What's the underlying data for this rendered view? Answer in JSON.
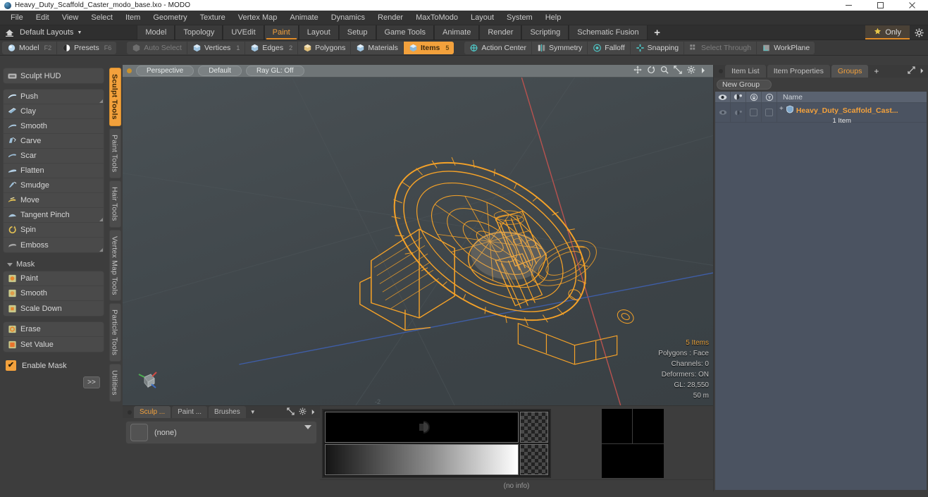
{
  "window": {
    "title": "Heavy_Duty_Scaffold_Caster_modo_base.lxo - MODO",
    "logo_icon": "modo-sphere-icon",
    "controls": [
      {
        "name": "minimize",
        "icon": "minimize-icon"
      },
      {
        "name": "maximize",
        "icon": "maximize-icon"
      },
      {
        "name": "close",
        "icon": "close-icon"
      }
    ]
  },
  "menubar": {
    "items": [
      "File",
      "Edit",
      "View",
      "Select",
      "Item",
      "Geometry",
      "Texture",
      "Vertex Map",
      "Animate",
      "Dynamics",
      "Render",
      "MaxToModo",
      "Layout",
      "System",
      "Help"
    ]
  },
  "layoutbar": {
    "home_icon": "home-icon",
    "layout_label": "Default Layouts",
    "caret_icon": "chevron-down-icon",
    "tabs": [
      {
        "label": "Model",
        "active": false
      },
      {
        "label": "Topology",
        "active": false
      },
      {
        "label": "UVEdit",
        "active": false
      },
      {
        "label": "Paint",
        "active": true
      },
      {
        "label": "Layout",
        "active": false
      },
      {
        "label": "Setup",
        "active": false
      },
      {
        "label": "Game Tools",
        "active": false
      },
      {
        "label": "Animate",
        "active": false
      },
      {
        "label": "Render",
        "active": false
      },
      {
        "label": "Scripting",
        "active": false
      },
      {
        "label": "Schematic Fusion",
        "active": false
      }
    ],
    "add_label": "+",
    "only_label": "Only",
    "only_icon": "star-icon",
    "gear_icon": "gear-icon",
    "accent": "#e08b27"
  },
  "modebar": {
    "left_group": [
      {
        "label": "Model",
        "key": "F2",
        "icon": "sphere-icon",
        "state": "normal"
      },
      {
        "label": "Presets",
        "key": "F6",
        "icon": "presets-icon",
        "state": "normal"
      }
    ],
    "select_group": [
      {
        "label": "Auto Select",
        "icon": "cube-icon",
        "state": "dim",
        "num": ""
      },
      {
        "label": "Vertices",
        "icon": "cube-vertex-icon",
        "state": "normal",
        "num": "1"
      },
      {
        "label": "Edges",
        "icon": "cube-edge-icon",
        "state": "normal",
        "num": "2"
      },
      {
        "label": "Polygons",
        "icon": "cube-poly-icon",
        "state": "normal",
        "num": ""
      },
      {
        "label": "Materials",
        "icon": "cube-material-icon",
        "state": "normal",
        "num": ""
      },
      {
        "label": "Items",
        "icon": "cube-item-icon",
        "state": "selected",
        "num": "5"
      }
    ],
    "tool_group": [
      {
        "label": "Action Center",
        "icon": "action-center-icon",
        "state": "normal"
      },
      {
        "label": "Symmetry",
        "icon": "symmetry-icon",
        "state": "normal"
      },
      {
        "label": "Falloff",
        "icon": "falloff-icon",
        "state": "normal"
      },
      {
        "label": "Snapping",
        "icon": "snapping-icon",
        "state": "normal"
      },
      {
        "label": "Select Through",
        "icon": "select-through-icon",
        "state": "dim"
      },
      {
        "label": "WorkPlane",
        "icon": "workplane-icon",
        "state": "normal"
      }
    ]
  },
  "left_panel": {
    "hud": {
      "label": "Sculpt HUD",
      "icon": "hud-icon"
    },
    "sculpt_tools": [
      {
        "label": "Push",
        "icon": "brush-push-icon",
        "corner": true
      },
      {
        "label": "Clay",
        "icon": "brush-clay-icon",
        "corner": false
      },
      {
        "label": "Smooth",
        "icon": "brush-smooth-icon",
        "corner": false
      },
      {
        "label": "Carve",
        "icon": "brush-carve-icon",
        "corner": false
      },
      {
        "label": "Scar",
        "icon": "brush-scar-icon",
        "corner": false
      },
      {
        "label": "Flatten",
        "icon": "brush-flatten-icon",
        "corner": false
      },
      {
        "label": "Smudge",
        "icon": "brush-smudge-icon",
        "corner": false
      },
      {
        "label": "Move",
        "icon": "brush-move-icon",
        "corner": false
      },
      {
        "label": "Tangent Pinch",
        "icon": "brush-pinch-icon",
        "corner": true
      },
      {
        "label": "Spin",
        "icon": "brush-spin-icon",
        "corner": false
      },
      {
        "label": "Emboss",
        "icon": "brush-emboss-icon",
        "corner": true
      }
    ],
    "mask_section": {
      "label": "Mask",
      "twirl_icon": "triangle-down-icon"
    },
    "mask_tools_a": [
      {
        "label": "Paint",
        "icon": "mask-paint-icon"
      },
      {
        "label": "Smooth",
        "icon": "mask-smooth-icon"
      },
      {
        "label": "Scale Down",
        "icon": "mask-scaledown-icon"
      }
    ],
    "mask_tools_b": [
      {
        "label": "Erase",
        "icon": "mask-erase-icon"
      },
      {
        "label": "Set Value",
        "icon": "mask-setvalue-icon"
      }
    ],
    "enable_mask": {
      "label": "Enable Mask",
      "checked": true,
      "check_icon": "check-icon"
    },
    "more_button": ">>"
  },
  "vertical_tabs": [
    {
      "label": "Sculpt Tools",
      "active": true
    },
    {
      "label": "Paint Tools",
      "active": false
    },
    {
      "label": "Hair Tools",
      "active": false
    },
    {
      "label": "Vertex Map Tools",
      "active": false
    },
    {
      "label": "Particle Tools",
      "active": false
    },
    {
      "label": "Utilities",
      "active": false
    }
  ],
  "viewport": {
    "header": {
      "indicator_icon": "lock-icon",
      "pills": [
        "Perspective",
        "Default",
        "Ray GL: Off"
      ],
      "icons": [
        "move-icon",
        "rotate-icon",
        "zoom-icon",
        "fit-icon",
        "gear-icon",
        "chevron-right-icon"
      ]
    },
    "axis_tick": "-2",
    "axis_widget_icon": "axis-gizmo-icon",
    "stats": [
      {
        "text": "5 Items",
        "highlight": true
      },
      {
        "text": "Polygons : Face",
        "highlight": false
      },
      {
        "text": "Channels: 0",
        "highlight": false
      },
      {
        "text": "Deformers: ON",
        "highlight": false
      },
      {
        "text": "GL: 28,550",
        "highlight": false
      },
      {
        "text": "50 m",
        "highlight": false
      }
    ],
    "model_color": "#f5a228",
    "axis_x_color": "#b8524f",
    "axis_z_color": "#3f5ea8"
  },
  "bottom_panel": {
    "tabs": [
      {
        "label": "Sculp ...",
        "active": true
      },
      {
        "label": "Paint ...",
        "active": false
      },
      {
        "label": "Brushes",
        "active": false
      }
    ],
    "caret_icon": "chevron-down-icon",
    "icons": [
      "expand-icon",
      "gear-icon",
      "chevron-right-icon"
    ],
    "preset": {
      "label": "(none)",
      "swatch_icon": "empty-swatch-icon",
      "caret_icon": "chevron-down-icon"
    },
    "status": "(no info)"
  },
  "right_panel": {
    "tabs": [
      {
        "label": "Item List",
        "active": false
      },
      {
        "label": "Item Properties",
        "active": false
      },
      {
        "label": "Groups",
        "active": true
      }
    ],
    "add_label": "+",
    "icons": [
      "expand-icon",
      "chevron-right-icon"
    ],
    "new_group_button": "New Group",
    "columns": [
      {
        "icon": "eye-icon",
        "name": "visibility-column"
      },
      {
        "icon": "render-icon",
        "name": "render-column"
      },
      {
        "icon": "lock-column-icon",
        "name": "lock-column"
      },
      {
        "icon": "select-column-icon",
        "name": "select-column"
      },
      {
        "label": "Name",
        "name": "name-column"
      }
    ],
    "rows": [
      {
        "expand": "+",
        "icon": "group-item-icon",
        "name": "Heavy_Duty_Scaffold_Cast...",
        "sub": "1 Item"
      }
    ]
  }
}
